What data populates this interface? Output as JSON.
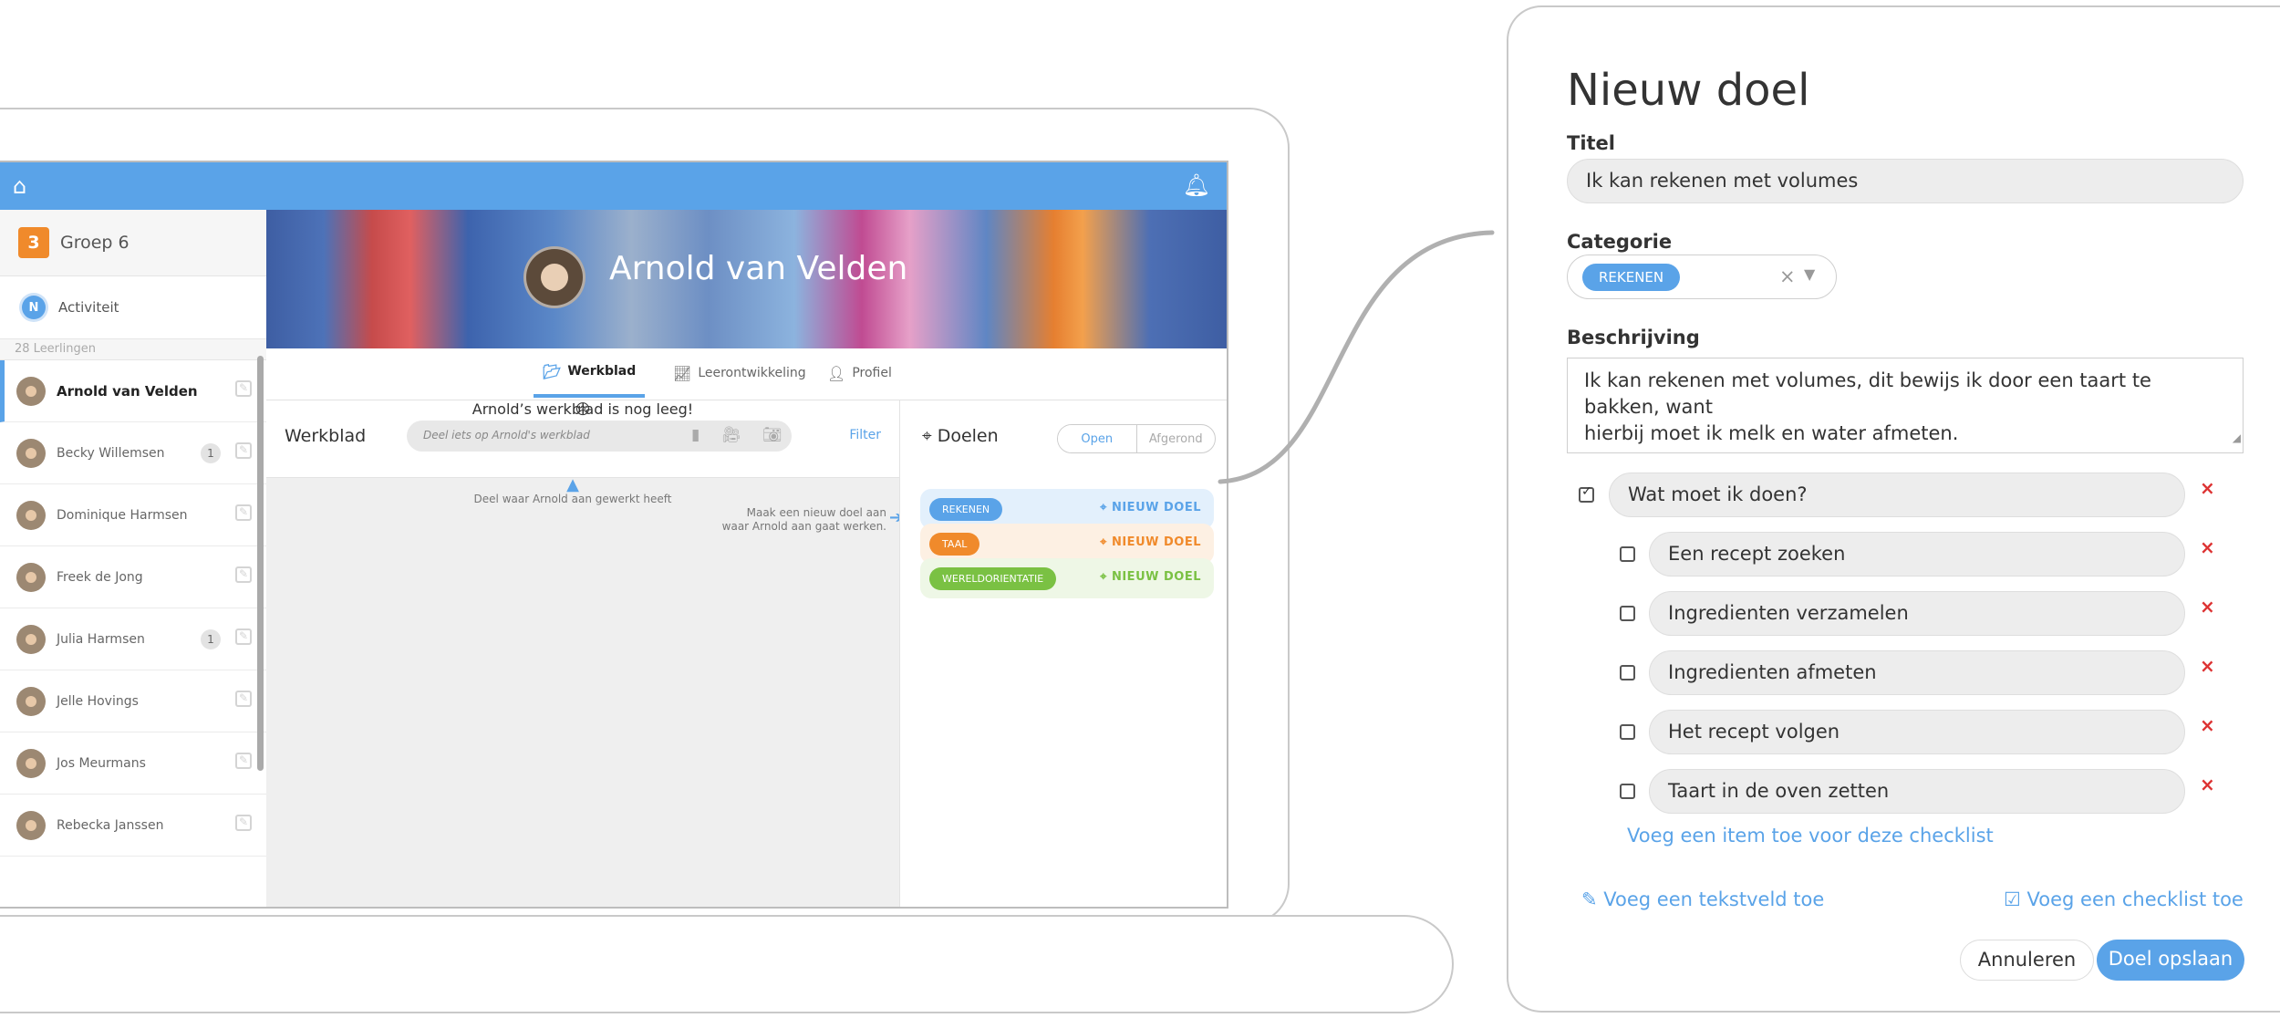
{
  "sidebar": {
    "group_number": "3",
    "group_name": "Groep 6",
    "activity_badge": "N",
    "activity_label": "Activiteit",
    "students_count_label": "28 Leerlingen",
    "students": [
      {
        "name": "Arnold van Velden",
        "count": ""
      },
      {
        "name": "Becky Willemsen",
        "count": "1"
      },
      {
        "name": "Dominique Harmsen",
        "count": ""
      },
      {
        "name": "Freek de Jong",
        "count": ""
      },
      {
        "name": "Julia Harmsen",
        "count": "1"
      },
      {
        "name": "Jelle Hovings",
        "count": ""
      },
      {
        "name": "Jos Meurmans",
        "count": ""
      },
      {
        "name": "Rebecka Janssen",
        "count": ""
      }
    ]
  },
  "header": {
    "student_name": "Arnold van Velden"
  },
  "tabs": [
    {
      "label": "Werkblad",
      "icon": "folder-icon"
    },
    {
      "label": "Leerontwikkeling",
      "icon": "chart-icon"
    },
    {
      "label": "Profiel",
      "icon": "person-icon"
    }
  ],
  "worksheet": {
    "title": "Werkblad",
    "share_placeholder": "Deel iets op Arnold's werkblad",
    "filter_label": "Filter",
    "hint_share": "Deel waar Arnold aan gewerkt heeft",
    "hint_goal_line1": "Maak een nieuw doel aan",
    "hint_goal_line2": "waar Arnold aan gaat werken.",
    "empty_emoji": "😢",
    "empty_message": "Arnold’s werkblad is nog leeg!"
  },
  "goals": {
    "title": "Doelen",
    "filter_open": "Open",
    "filter_done": "Afgerond",
    "new_goal_label": "NIEUW DOEL",
    "categories": [
      {
        "label": "REKENEN",
        "color": "#5aa3e8",
        "bg": "#e3f0fc"
      },
      {
        "label": "TAAL",
        "color": "#f08a2b",
        "bg": "#fdf0e3"
      },
      {
        "label": "WERELDORIENTATIE",
        "color": "#7ac143",
        "bg": "#eef7e6"
      }
    ]
  },
  "form": {
    "title": "Nieuw doel",
    "title_label": "Titel",
    "title_value": "Ik kan rekenen met volumes",
    "category_label": "Categorie",
    "category_value": "REKENEN",
    "description_label": "Beschrijving",
    "description_line1": "Ik kan rekenen met volumes, dit bewijs ik door een taart te bakken, want",
    "description_line2": "hierbij moet ik melk en water afmeten.",
    "checklist_title": "Wat moet ik doen?",
    "checklist_items": [
      "Een recept zoeken",
      "Ingredienten verzamelen",
      "Ingredienten afmeten",
      "Het recept volgen",
      "Taart in de oven zetten"
    ],
    "add_checklist_item": "Voeg een item toe voor deze checklist",
    "add_textfield": "Voeg een tekstveld toe",
    "add_checklist": "Voeg een checklist toe",
    "cancel_label": "Annuleren",
    "save_label": "Doel opslaan"
  },
  "colors": {
    "accent": "#5aa3e8",
    "orange": "#f08a2b",
    "green": "#7ac143",
    "delete": "#d33333"
  }
}
